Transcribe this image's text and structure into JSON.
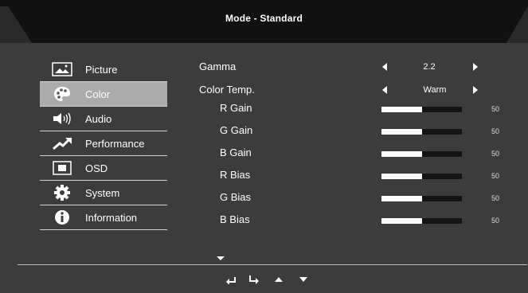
{
  "title": "Mode - Standard",
  "sidebar": {
    "items": [
      {
        "label": "Picture",
        "icon": "picture-icon",
        "active": false
      },
      {
        "label": "Color",
        "icon": "palette-icon",
        "active": true
      },
      {
        "label": "Audio",
        "icon": "speaker-icon",
        "active": false
      },
      {
        "label": "Performance",
        "icon": "trend-arrow-icon",
        "active": false
      },
      {
        "label": "OSD",
        "icon": "osd-screen-icon",
        "active": false
      },
      {
        "label": "System",
        "icon": "gear-icon",
        "active": false
      },
      {
        "label": "Information",
        "icon": "info-icon",
        "active": false
      }
    ]
  },
  "settings": {
    "gamma": {
      "label": "Gamma",
      "value": "2.2"
    },
    "color_temp": {
      "label": "Color Temp.",
      "value": "Warm"
    },
    "sliders": [
      {
        "label": "R Gain",
        "value": "50",
        "level": 0.5
      },
      {
        "label": "G Gain",
        "value": "50",
        "level": 0.5
      },
      {
        "label": "B Gain",
        "value": "50",
        "level": 0.5
      },
      {
        "label": "R Bias",
        "value": "50",
        "level": 0.5
      },
      {
        "label": "G Bias",
        "value": "50",
        "level": 0.5
      },
      {
        "label": "B Bias",
        "value": "50",
        "level": 0.5
      }
    ]
  },
  "footer": {
    "icons": [
      "back-icon",
      "enter-icon",
      "up-arrow-icon",
      "down-arrow-icon"
    ]
  },
  "colors": {
    "background": "#3c3c3c",
    "header": "#111111",
    "active_item": "#ababab",
    "slider_fill": "#ffffff",
    "slider_track": "#141414"
  }
}
